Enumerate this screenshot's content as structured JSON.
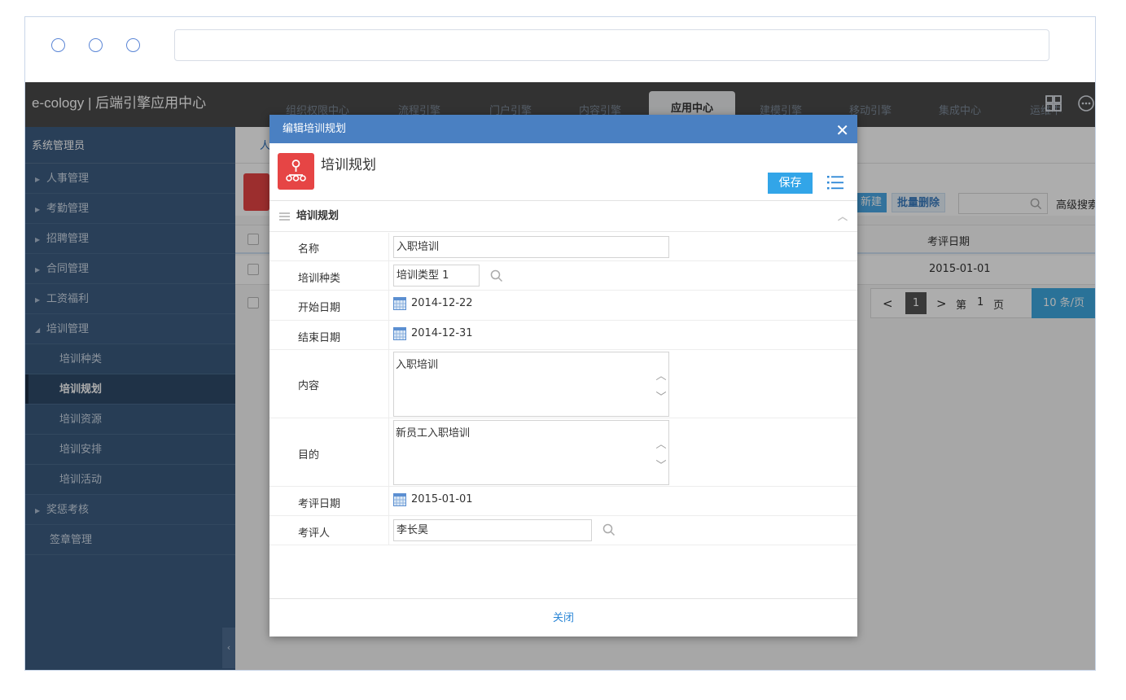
{
  "app": {
    "brand": "e-cology | 后端引擎应用中心",
    "admin": "系统管理员"
  },
  "sidebar": {
    "items": [
      {
        "label": "人事管理",
        "type": "group"
      },
      {
        "label": "考勤管理",
        "type": "group"
      },
      {
        "label": "招聘管理",
        "type": "group"
      },
      {
        "label": "合同管理",
        "type": "group"
      },
      {
        "label": "工资福利",
        "type": "group"
      },
      {
        "label": "培训管理",
        "type": "group-open"
      },
      {
        "label": "培训种类",
        "type": "sub"
      },
      {
        "label": "培训规划",
        "type": "sub-active"
      },
      {
        "label": "培训资源",
        "type": "sub"
      },
      {
        "label": "培训安排",
        "type": "sub"
      },
      {
        "label": "培训活动",
        "type": "sub"
      },
      {
        "label": "奖惩考核",
        "type": "group"
      },
      {
        "label": "签章管理",
        "type": "plain"
      }
    ],
    "collapse": "‹"
  },
  "topnav": {
    "tabs": [
      "组织权限中心",
      "流程引擎",
      "门户引擎",
      "内容引擎",
      "应用中心",
      "建模引擎",
      "移动引擎",
      "集成中心",
      "运维中心"
    ],
    "active": "应用中心"
  },
  "background": {
    "crumb": "人",
    "btn_new": "新建",
    "btn_batch_delete": "批量删除",
    "advanced_search": "高级搜索",
    "column_eval_date": "考评日期",
    "row_eval_date": "2015-01-01",
    "pager": {
      "prev": "<",
      "page": "1",
      "next": ">",
      "label_pre": "第",
      "current": "1",
      "label_post": "页",
      "per_page": "10 条/页"
    }
  },
  "dialog": {
    "title": "编辑培训规划",
    "heading": "培训规划",
    "save_label": "保存",
    "section": "培训规划",
    "close_label": "关闭",
    "fields": {
      "name": {
        "label": "名称",
        "value": "入职培训"
      },
      "type": {
        "label": "培训种类",
        "value": "培训类型 1"
      },
      "start": {
        "label": "开始日期",
        "value": "2014-12-22"
      },
      "end": {
        "label": "结束日期",
        "value": "2014-12-31"
      },
      "content": {
        "label": "内容",
        "value": "入职培训"
      },
      "purpose": {
        "label": "目的",
        "value": "新员工入职培训"
      },
      "eval_date": {
        "label": "考评日期",
        "value": "2015-01-01"
      },
      "evaluator": {
        "label": "考评人",
        "value": "李长昊"
      }
    }
  },
  "colors": {
    "sidebar": "#3d5d82",
    "dialog_title": "#4a80c2",
    "accent_red": "#e64545",
    "save_blue": "#32a5e8"
  }
}
